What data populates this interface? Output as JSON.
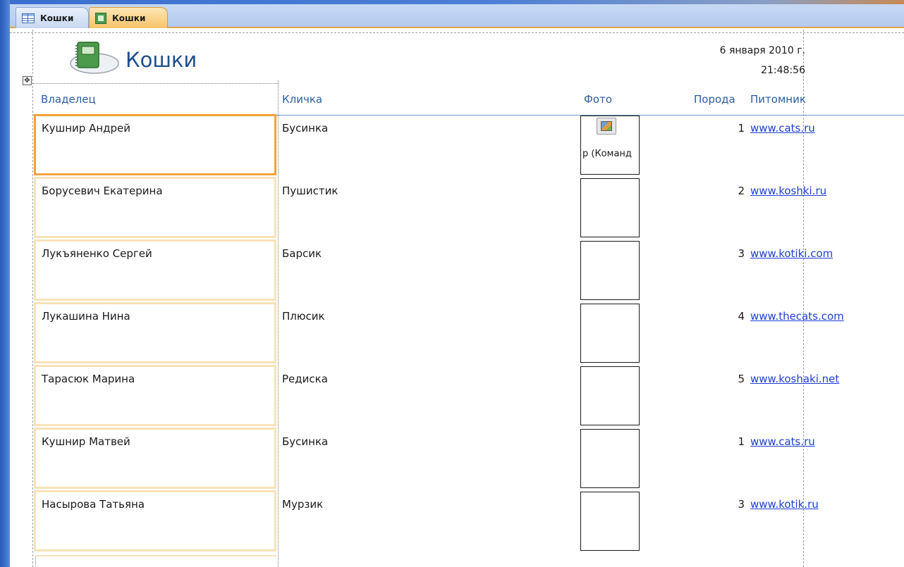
{
  "tabs": [
    {
      "label": "Кошки",
      "icon": "table-icon",
      "active": false
    },
    {
      "label": "Кошки",
      "icon": "report-icon",
      "active": true
    }
  ],
  "report": {
    "title": "Кошки",
    "date": "6 января 2010 г.",
    "time": "21:48:56"
  },
  "columns": {
    "owner": "Владелец",
    "nick": "Кличка",
    "photo": "Фото",
    "breed": "Порода",
    "nursery": "Питомник"
  },
  "rows": [
    {
      "owner": "Кушнир Андрей",
      "nick": "Бусинка",
      "photo_caption": "р (Команд",
      "breed": "1",
      "nursery": "www.cats.ru"
    },
    {
      "owner": "Борусевич Екатерина",
      "nick": "Пушистик",
      "photo_caption": "",
      "breed": "2",
      "nursery": "www.koshki.ru"
    },
    {
      "owner": "Лукъяненко Сергей",
      "nick": "Барсик",
      "photo_caption": "",
      "breed": "3",
      "nursery": "www.kotiki.com"
    },
    {
      "owner": "Лукашина Нина",
      "nick": "Плюсик",
      "photo_caption": "",
      "breed": "4",
      "nursery": "www.thecats.com"
    },
    {
      "owner": "Тарасюк Марина",
      "nick": "Редиска",
      "photo_caption": "",
      "breed": "5",
      "nursery": "www.koshaki.net"
    },
    {
      "owner": "Кушнир Матвей",
      "nick": "Бусинка",
      "photo_caption": "",
      "breed": "1",
      "nursery": "www.cats.ru"
    },
    {
      "owner": "Насырова Татьяна",
      "nick": "Мурзик",
      "photo_caption": "",
      "breed": "3",
      "nursery": "www.kotik.ru"
    }
  ],
  "colors": {
    "header_text": "#2a5e9e",
    "link": "#1f3fd6",
    "selected_border": "#f2a23a"
  }
}
